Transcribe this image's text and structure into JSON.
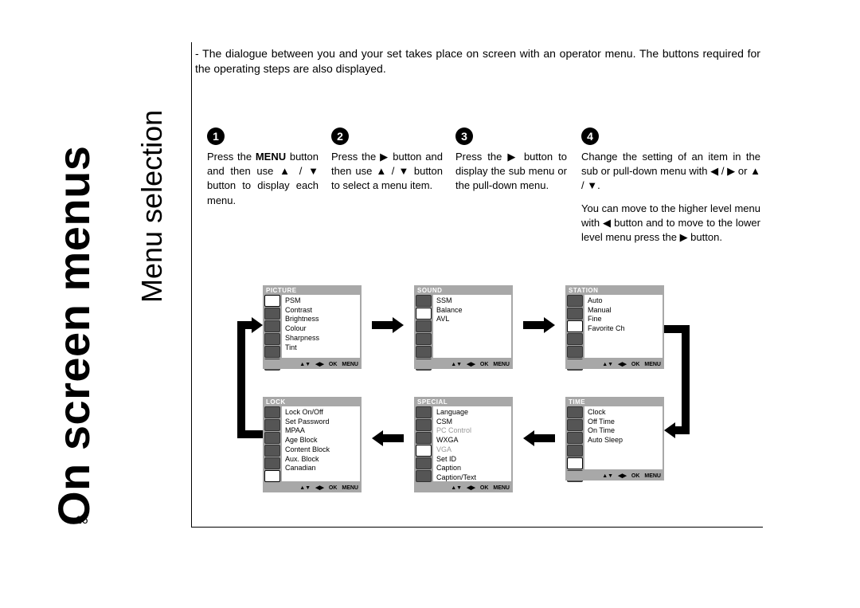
{
  "title_big": "On screen menus",
  "title_small": "Menu selection",
  "page_number": "16",
  "intro": "The dialogue between you and your set takes place on screen with an operator menu. The buttons required for the operating steps are also displayed.",
  "steps": {
    "s1_num": "1",
    "s1_a": "Press the ",
    "s1_menubold": "MENU",
    "s1_b": " button and then use ▲ / ▼ button to display each menu.",
    "s2_num": "2",
    "s2": "Press the ▶ button and then use ▲ / ▼ button to select a menu item.",
    "s3_num": "3",
    "s3": "Press the ▶ button to display the sub menu or the pull-down menu.",
    "s4_num": "4",
    "s4a": "Change the setting of an item in the sub or pull-down menu with ◀ / ▶ or ▲ / ▼.",
    "s4b": "You can move to the higher level menu with ◀ button and to move to the lower level menu press the ▶ button."
  },
  "panes": {
    "picture": {
      "hd": "PICTURE",
      "items": [
        "PSM",
        "Contrast",
        "Brightness",
        "Colour",
        "Sharpness",
        "Tint"
      ]
    },
    "sound": {
      "hd": "SOUND",
      "items": [
        "SSM",
        "Balance",
        "AVL"
      ]
    },
    "station": {
      "hd": "STATION",
      "items": [
        "Auto",
        "Manual",
        "Fine",
        "Favorite Ch"
      ]
    },
    "lock": {
      "hd": "LOCK",
      "items": [
        "Lock On/Off",
        "Set Password",
        "MPAA",
        "Age Block",
        "Content Block",
        "Aux. Block",
        "Canadian"
      ]
    },
    "special": {
      "hd": "SPECIAL",
      "items": [
        "Language",
        "CSM",
        "PC Control",
        "WXGA",
        "VGA",
        "Set ID",
        "Caption",
        "Caption/Text"
      ],
      "dim": [
        2,
        4
      ]
    },
    "time": {
      "hd": "TIME",
      "items": [
        "Clock",
        "Off Time",
        "On Time",
        "Auto Sleep"
      ]
    },
    "footer": {
      "nav": "▲▼",
      "lr": "◀▶",
      "ok": "OK",
      "menu": "MENU"
    }
  }
}
